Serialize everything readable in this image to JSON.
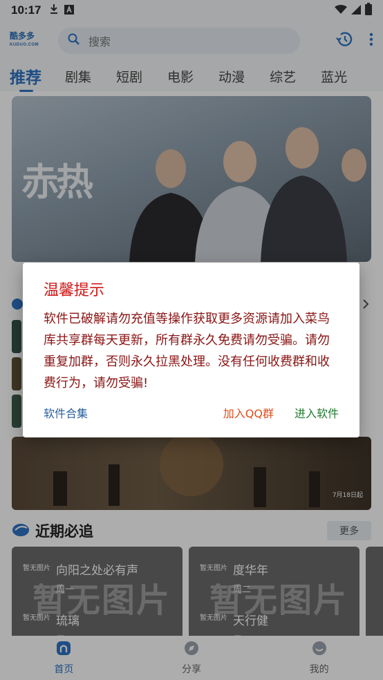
{
  "status_bar": {
    "time": "10:17",
    "icons": [
      "download-icon",
      "a-icon",
      "wifi-icon",
      "signal-icon",
      "battery-icon"
    ]
  },
  "app_bar": {
    "logo_text": "酷多多",
    "logo_sub": "KUDUO.COM",
    "search_placeholder": "搜索",
    "actions": [
      "history-icon",
      "more-vert-icon"
    ]
  },
  "tabs": [
    {
      "label": "推荐",
      "active": true
    },
    {
      "label": "剧集"
    },
    {
      "label": "短剧"
    },
    {
      "label": "电影"
    },
    {
      "label": "动漫"
    },
    {
      "label": "综艺"
    },
    {
      "label": "蓝光"
    }
  ],
  "banner": {
    "title_art": "赤热"
  },
  "strip": {
    "date_text": "7月18日起"
  },
  "section": {
    "title": "近期必追",
    "more_label": "更多"
  },
  "cards": [
    {
      "placeholder": "暂无图片",
      "tag": "暂无图片",
      "title1": "向阳之处必有声",
      "sub1": "周一",
      "title2": "琉璃",
      "sub2": "周一"
    },
    {
      "placeholder": "暂无图片",
      "tag": "暂无图片",
      "title1": "度华年",
      "sub1": "周二",
      "title2": "天行健",
      "sub2": "周二"
    }
  ],
  "bottom_nav": [
    {
      "label": "首页",
      "icon": "home-icon",
      "active": true
    },
    {
      "label": "分享",
      "icon": "compass-icon"
    },
    {
      "label": "我的",
      "icon": "smile-icon"
    }
  ],
  "dialog": {
    "title": "温馨提示",
    "message": "软件已破解请勿充值等操作获取更多资源请加入菜鸟库共享群每天更新，所有群永久免费请勿受骗。请勿重复加群，否则永久拉黑处理。没有任何收费群和收费行为，请勿受骗!",
    "button_left": "软件合集",
    "button_mid": "加入QQ群",
    "button_right": "进入软件"
  },
  "colors": {
    "accent": "#2e74c4",
    "dialog_title": "#d11616",
    "dialog_message": "#8a1414",
    "btn_left": "#2a5f9c",
    "btn_mid": "#e04d1c",
    "btn_right": "#1d7a2e"
  }
}
